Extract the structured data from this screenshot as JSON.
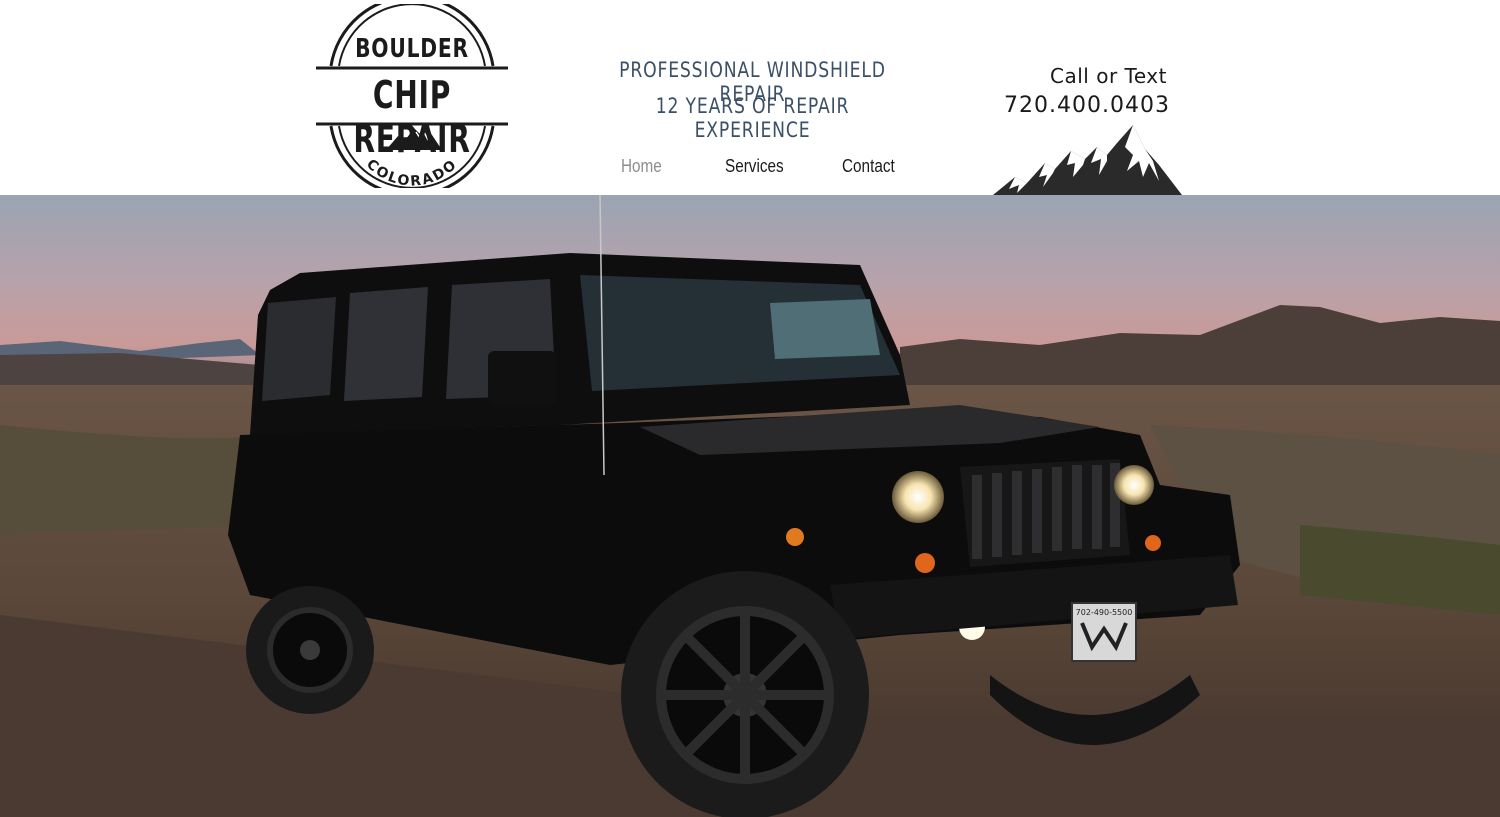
{
  "logo": {
    "top_word": "BOULDER",
    "main_word": "CHIP REPAIR",
    "bottom_word": "COLORADO"
  },
  "taglines": {
    "line1": "Professional Windshield Repair",
    "line2": "12 Years of Repair Experience"
  },
  "nav": {
    "items": [
      {
        "label": "Home",
        "active": true
      },
      {
        "label": "Services",
        "active": false
      },
      {
        "label": "Contact",
        "active": false
      }
    ]
  },
  "contact": {
    "label": "Call or Text",
    "phone": "720.400.0403"
  },
  "hero": {
    "plate_text": "702-490-5500"
  },
  "colors": {
    "tagline": "#3b4f66",
    "nav_active": "#8d8d8d",
    "text_dark": "#1a1a1a"
  },
  "icons": [
    "logo-emblem",
    "mountain-icon"
  ]
}
